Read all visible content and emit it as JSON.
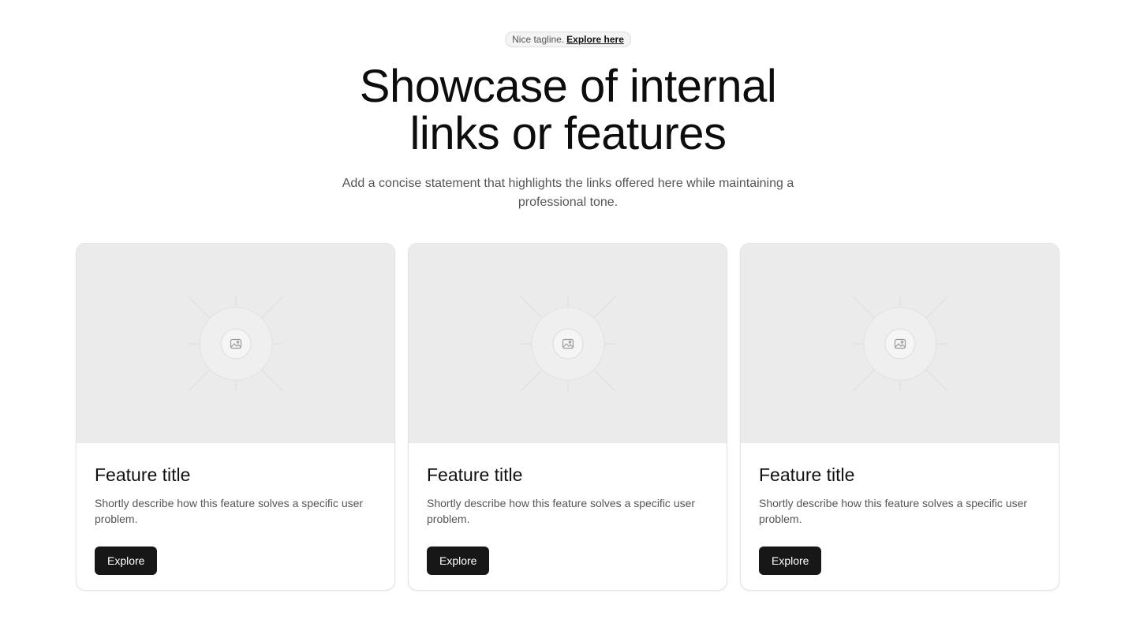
{
  "tagline": {
    "text": "Nice tagline.",
    "link": "Explore here"
  },
  "headline": {
    "line1": "Showcase of internal",
    "line2": "links or features"
  },
  "lead": "Add a concise statement that highlights the links offered here while maintaining a professional tone.",
  "cards": [
    {
      "title": "Feature title",
      "description": "Shortly describe how this feature solves a specific user problem.",
      "button": "Explore",
      "image_icon": "image-placeholder-icon"
    },
    {
      "title": "Feature title",
      "description": "Shortly describe how this feature solves a specific user problem.",
      "button": "Explore",
      "image_icon": "image-placeholder-icon"
    },
    {
      "title": "Feature title",
      "description": "Shortly describe how this feature solves a specific user problem.",
      "button": "Explore",
      "image_icon": "image-placeholder-icon"
    }
  ],
  "colors": {
    "background": "#ffffff",
    "button": "#171717",
    "placeholder": "#ebebeb",
    "text_muted": "#555555"
  }
}
